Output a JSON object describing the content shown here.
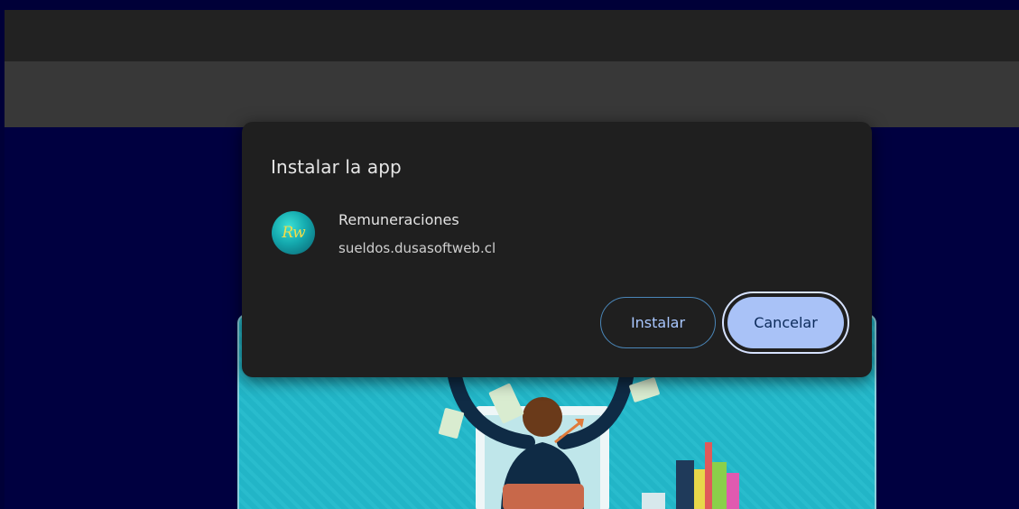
{
  "dialog": {
    "title": "Instalar la app",
    "app": {
      "name": "Remuneraciones",
      "url": "sueldos.dusasoftweb.cl",
      "icon_text": "Rw"
    },
    "buttons": {
      "install": "Instalar",
      "cancel": "Cancelar"
    }
  },
  "colors": {
    "page_background": "#000038",
    "dialog_background": "#1f1f1f",
    "primary_button": "#a9c2f7",
    "outline_button_border": "#4a86b8",
    "banner": "#22b5c7"
  },
  "icons": [
    "app-logo-icon",
    "illustration-person-money"
  ]
}
